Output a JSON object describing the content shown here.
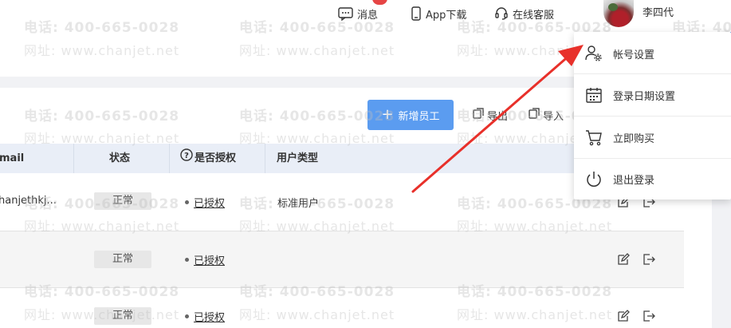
{
  "topbar": {
    "messages_label": "消息",
    "messages_badge": "···",
    "app_download_label": "App下载",
    "support_label": "在线客服",
    "username": "李四代"
  },
  "toolbar": {
    "add_employee_label": "新增员工",
    "export_label": "导出",
    "import_label": "导入"
  },
  "table": {
    "columns": [
      "mail",
      "状态",
      "是否授权",
      "用户类型"
    ],
    "rows": [
      {
        "email": "hanjethkj...",
        "status": "正常",
        "auth": "已授权",
        "user_type": "标准用户"
      },
      {
        "email": "",
        "status": "正常",
        "auth": "已授权",
        "user_type": ""
      },
      {
        "email": "",
        "status": "正常",
        "auth": "已授权",
        "user_type": ""
      }
    ]
  },
  "dropdown": {
    "items": [
      {
        "label": "帐号设置",
        "icon": "user-gear-icon"
      },
      {
        "label": "登录日期设置",
        "icon": "calendar-icon"
      },
      {
        "label": "立即购买",
        "icon": "cart-icon"
      },
      {
        "label": "退出登录",
        "icon": "power-icon"
      }
    ]
  },
  "watermark": {
    "phone": "电话: 400-665-0028",
    "site": "网址: www.chanjet.net"
  },
  "colors": {
    "primary_button": "#5b9cf0",
    "table_header_bg": "#e9eef7",
    "annotation_arrow": "#e8302a",
    "badge": "#e64545"
  }
}
